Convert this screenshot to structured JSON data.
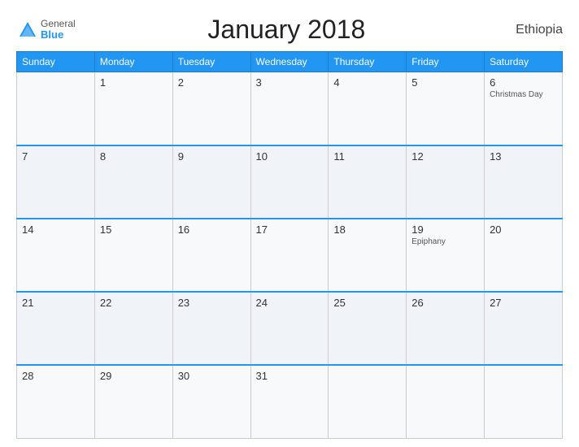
{
  "header": {
    "logo_general": "General",
    "logo_blue": "Blue",
    "title": "January 2018",
    "country": "Ethiopia"
  },
  "weekdays": [
    "Sunday",
    "Monday",
    "Tuesday",
    "Wednesday",
    "Thursday",
    "Friday",
    "Saturday"
  ],
  "weeks": [
    [
      {
        "day": "",
        "holiday": ""
      },
      {
        "day": "1",
        "holiday": ""
      },
      {
        "day": "2",
        "holiday": ""
      },
      {
        "day": "3",
        "holiday": ""
      },
      {
        "day": "4",
        "holiday": ""
      },
      {
        "day": "5",
        "holiday": ""
      },
      {
        "day": "6",
        "holiday": "Christmas Day"
      }
    ],
    [
      {
        "day": "7",
        "holiday": ""
      },
      {
        "day": "8",
        "holiday": ""
      },
      {
        "day": "9",
        "holiday": ""
      },
      {
        "day": "10",
        "holiday": ""
      },
      {
        "day": "11",
        "holiday": ""
      },
      {
        "day": "12",
        "holiday": ""
      },
      {
        "day": "13",
        "holiday": ""
      }
    ],
    [
      {
        "day": "14",
        "holiday": ""
      },
      {
        "day": "15",
        "holiday": ""
      },
      {
        "day": "16",
        "holiday": ""
      },
      {
        "day": "17",
        "holiday": ""
      },
      {
        "day": "18",
        "holiday": ""
      },
      {
        "day": "19",
        "holiday": "Epiphany"
      },
      {
        "day": "20",
        "holiday": ""
      }
    ],
    [
      {
        "day": "21",
        "holiday": ""
      },
      {
        "day": "22",
        "holiday": ""
      },
      {
        "day": "23",
        "holiday": ""
      },
      {
        "day": "24",
        "holiday": ""
      },
      {
        "day": "25",
        "holiday": ""
      },
      {
        "day": "26",
        "holiday": ""
      },
      {
        "day": "27",
        "holiday": ""
      }
    ],
    [
      {
        "day": "28",
        "holiday": ""
      },
      {
        "day": "29",
        "holiday": ""
      },
      {
        "day": "30",
        "holiday": ""
      },
      {
        "day": "31",
        "holiday": ""
      },
      {
        "day": "",
        "holiday": ""
      },
      {
        "day": "",
        "holiday": ""
      },
      {
        "day": "",
        "holiday": ""
      }
    ]
  ]
}
